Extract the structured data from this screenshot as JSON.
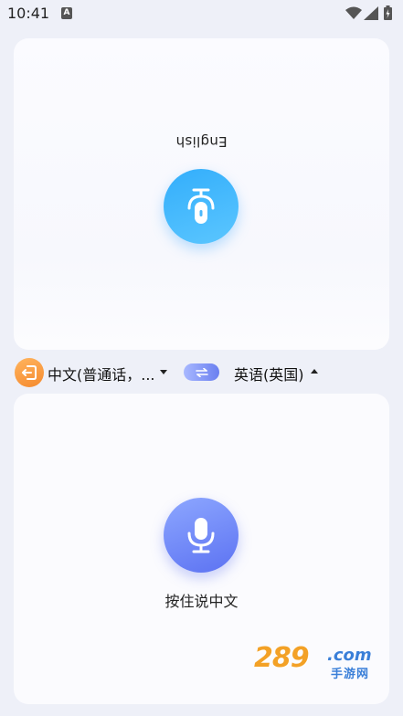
{
  "status_bar": {
    "time": "10:41",
    "notification_icon": "A"
  },
  "top_panel": {
    "language_label": "English",
    "mic_icon": "mic-icon-flipped",
    "accent_color": "#3fb6fd"
  },
  "language_bar": {
    "exit_icon": "exit-icon",
    "source_language": "中文(普通话，...",
    "swap_icon": "swap-arrows-icon",
    "target_language": "英语(英国)",
    "exit_color": "#f79a3c",
    "swap_color": "#7c8ff5"
  },
  "bottom_panel": {
    "mic_icon": "mic-icon",
    "hold_to_speak_label": "按住说中文",
    "accent_color": "#6d82f5"
  },
  "watermark": {
    "number": "289",
    "domain": ".com",
    "subtitle": "手游网"
  }
}
